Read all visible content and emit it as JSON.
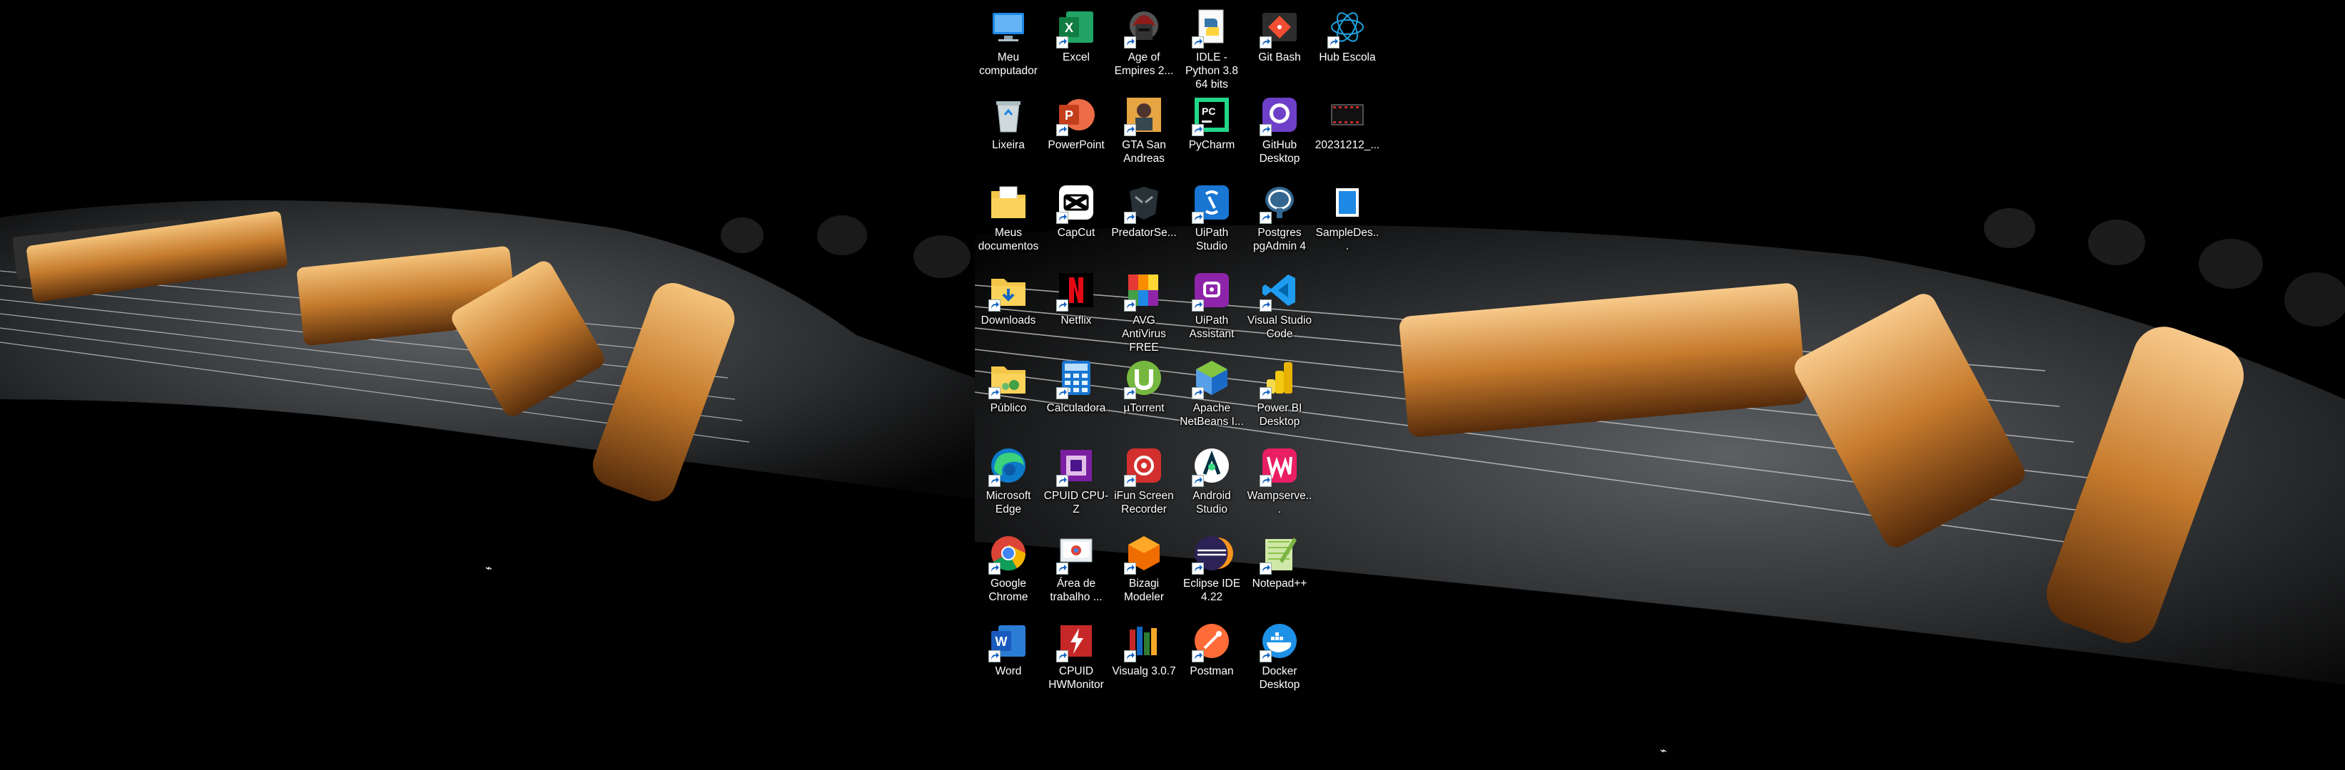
{
  "desktop": {
    "columns": [
      {
        "column": "c1",
        "icons": [
          {
            "label": "Meu computador",
            "icon": "computer-icon",
            "shortcut": false
          },
          {
            "label": "Lixeira",
            "icon": "recycle-bin-icon",
            "shortcut": false
          },
          {
            "label": "Meus documentos",
            "icon": "folder-documents-icon",
            "shortcut": false
          },
          {
            "label": "Downloads",
            "icon": "folder-downloads-icon",
            "shortcut": true
          },
          {
            "label": "Público",
            "icon": "folder-public-icon",
            "shortcut": true
          },
          {
            "label": "Microsoft Edge",
            "icon": "edge-icon",
            "shortcut": true
          },
          {
            "label": "Google Chrome",
            "icon": "chrome-icon",
            "shortcut": true
          },
          {
            "label": "Word",
            "icon": "word-icon",
            "shortcut": true
          }
        ]
      },
      {
        "column": "c2",
        "icons": [
          {
            "label": "Excel",
            "icon": "excel-icon",
            "shortcut": true
          },
          {
            "label": "PowerPoint",
            "icon": "powerpoint-icon",
            "shortcut": true
          },
          {
            "label": "CapCut",
            "icon": "capcut-icon",
            "shortcut": true
          },
          {
            "label": "Netflix",
            "icon": "netflix-icon",
            "shortcut": true
          },
          {
            "label": "Calculadora",
            "icon": "calculator-icon",
            "shortcut": true
          },
          {
            "label": "CPUID CPU-Z",
            "icon": "cpuz-icon",
            "shortcut": true
          },
          {
            "label": "Área de trabalho ...",
            "icon": "remote-desktop-icon",
            "shortcut": true
          },
          {
            "label": "CPUID HWMonitor",
            "icon": "hwmonitor-icon",
            "shortcut": true
          }
        ]
      },
      {
        "column": "c3",
        "icons": [
          {
            "label": "Age of Empires 2...",
            "icon": "age-of-empires-icon",
            "shortcut": true
          },
          {
            "label": "GTA San Andreas",
            "icon": "gta-icon",
            "shortcut": true
          },
          {
            "label": "PredatorSe...",
            "icon": "predator-icon",
            "shortcut": true
          },
          {
            "label": "AVG AntiVirus FREE",
            "icon": "avg-icon",
            "shortcut": true
          },
          {
            "label": "µTorrent",
            "icon": "utorrent-icon",
            "shortcut": true
          },
          {
            "label": "iFun Screen Recorder",
            "icon": "ifun-recorder-icon",
            "shortcut": true
          },
          {
            "label": "Bizagi Modeler",
            "icon": "bizagi-icon",
            "shortcut": true
          },
          {
            "label": "Visualg 3.0.7",
            "icon": "visualg-icon",
            "shortcut": true
          }
        ]
      },
      {
        "column": "c4",
        "icons": [
          {
            "label": "IDLE - Python 3.8 64 bits",
            "icon": "python-idle-icon",
            "shortcut": true
          },
          {
            "label": "PyCharm",
            "icon": "pycharm-icon",
            "shortcut": true
          },
          {
            "label": "UiPath Studio",
            "icon": "uipath-studio-icon",
            "shortcut": true
          },
          {
            "label": "UiPath Assistant",
            "icon": "uipath-assistant-icon",
            "shortcut": true
          },
          {
            "label": "Apache NetBeans I...",
            "icon": "netbeans-icon",
            "shortcut": true
          },
          {
            "label": "Android Studio",
            "icon": "android-studio-icon",
            "shortcut": true
          },
          {
            "label": "Eclipse IDE 4.22",
            "icon": "eclipse-icon",
            "shortcut": true
          },
          {
            "label": "Postman",
            "icon": "postman-icon",
            "shortcut": true
          }
        ]
      },
      {
        "column": "c5",
        "icons": [
          {
            "label": "Git Bash",
            "icon": "git-bash-icon",
            "shortcut": true
          },
          {
            "label": "GitHub Desktop",
            "icon": "github-desktop-icon",
            "shortcut": true
          },
          {
            "label": "Postgres pgAdmin 4",
            "icon": "pgadmin-icon",
            "shortcut": true
          },
          {
            "label": "Visual Studio Code",
            "icon": "vscode-icon",
            "shortcut": true
          },
          {
            "label": "Power BI Desktop",
            "icon": "powerbi-icon",
            "shortcut": true
          },
          {
            "label": "Wampserve...",
            "icon": "wampserver-icon",
            "shortcut": true
          },
          {
            "label": "Notepad++",
            "icon": "notepadpp-icon",
            "shortcut": true
          },
          {
            "label": "Docker Desktop",
            "icon": "docker-icon",
            "shortcut": true
          }
        ]
      },
      {
        "column": "c6",
        "icons": [
          {
            "label": "Hub Escola",
            "icon": "hub-escola-icon",
            "shortcut": true
          },
          {
            "label": "20231212_...",
            "icon": "video-file-icon",
            "shortcut": false
          },
          {
            "label": "SampleDes...",
            "icon": "blue-file-icon",
            "shortcut": false
          }
        ]
      }
    ]
  },
  "colors": {
    "wallpaper_bg": "#000000",
    "label_text": "#ffffff",
    "accent_gold": "#d9953f"
  }
}
